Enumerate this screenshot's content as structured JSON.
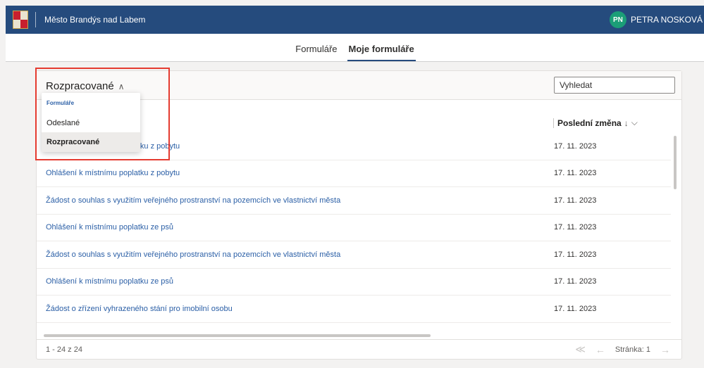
{
  "header": {
    "app_title": "Město Brandýs nad Labem",
    "user_initials": "PN",
    "user_name": "PETRA NOSKOVÁ",
    "coat_icon": "coat-of-arms-icon"
  },
  "tabs": [
    {
      "label": "Formuláře",
      "active": false
    },
    {
      "label": "Moje formuláře",
      "active": true
    }
  ],
  "filter": {
    "selected": "Rozpracované",
    "chevron": "∧",
    "menu_header": "Formuláře",
    "options": [
      "Odeslané",
      "Rozpracované"
    ]
  },
  "search": {
    "placeholder": "Vyhledat"
  },
  "table": {
    "column_last_change": "Poslední změna",
    "sort_arrow": "↓",
    "column_menu": "⌵",
    "rows": [
      {
        "name": "Ohlášení k místnímu poplatku z pobytu",
        "date": "17. 11. 2023"
      },
      {
        "name": "Ohlášení k místnímu poplatku z pobytu",
        "date": "17. 11. 2023"
      },
      {
        "name": "Žádost o souhlas s využitím veřejného prostranství na pozemcích ve vlastnictví města",
        "date": "17. 11. 2023"
      },
      {
        "name": "Ohlášení k místnímu poplatku ze psů",
        "date": "17. 11. 2023"
      },
      {
        "name": "Žádost o souhlas s využitím veřejného prostranství na pozemcích ve vlastnictví města",
        "date": "17. 11. 2023"
      },
      {
        "name": "Ohlášení k místnímu poplatku ze psů",
        "date": "17. 11. 2023"
      },
      {
        "name": "Žádost o zřízení vyhrazeného stání pro imobilní osobu",
        "date": "17. 11. 2023"
      }
    ]
  },
  "footer": {
    "range": "1 - 24 z 24",
    "first_icon": "≪",
    "prev_icon": "←",
    "page_label": "Stránka: 1",
    "next_icon": "→"
  },
  "colors": {
    "header_bg": "#254b7d",
    "link": "#2b5fa6",
    "highlight": "#e53b30"
  }
}
